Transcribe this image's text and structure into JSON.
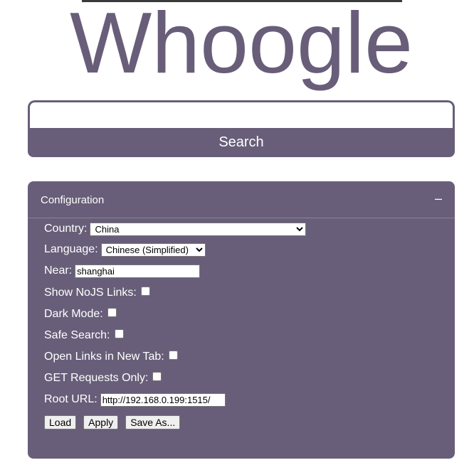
{
  "app": {
    "logo_text": "Whoogle",
    "logo_color": "#685e79"
  },
  "search": {
    "input_value": "",
    "button_label": "Search"
  },
  "config": {
    "title": "Configuration",
    "collapse_symbol": "–",
    "country": {
      "label": "Country:",
      "value": "China"
    },
    "language": {
      "label": "Language:",
      "value": "Chinese (Simplified)"
    },
    "near": {
      "label": "Near:",
      "value": "shanghai"
    },
    "nojs": {
      "label": "Show NoJS Links:",
      "checked": false
    },
    "dark": {
      "label": "Dark Mode:",
      "checked": false
    },
    "safe": {
      "label": "Safe Search:",
      "checked": false
    },
    "newtab": {
      "label": "Open Links in New Tab:",
      "checked": false
    },
    "get_only": {
      "label": "GET Requests Only:",
      "checked": false
    },
    "root_url": {
      "label": "Root URL:",
      "value": "http://192.168.0.199:1515/"
    },
    "buttons": {
      "load": "Load",
      "apply": "Apply",
      "save_as": "Save As..."
    }
  },
  "colors": {
    "accent": "#685e79",
    "panel_text": "#ffffff"
  }
}
